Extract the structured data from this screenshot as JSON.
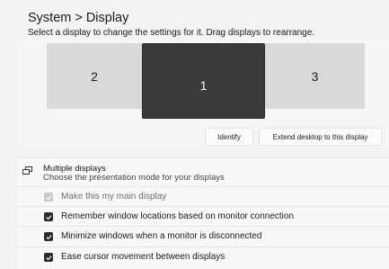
{
  "breadcrumb": {
    "parent": "System",
    "separator": ">",
    "current": "Display"
  },
  "instructions": "Select a display to change the settings for it. Drag displays to rearrange.",
  "monitors": [
    {
      "label": "2",
      "selected": false
    },
    {
      "label": "1",
      "selected": true
    },
    {
      "label": "3",
      "selected": false
    }
  ],
  "buttons": {
    "identify": "Identify",
    "extend": "Extend desktop to this display"
  },
  "multiple_displays": {
    "icon": "multiple-displays-icon",
    "title": "Multiple displays",
    "subtitle": "Choose the presentation mode for your displays",
    "options": [
      {
        "label": "Make this my main display",
        "checked": true,
        "disabled": true
      },
      {
        "label": "Remember window locations based on monitor connection",
        "checked": true,
        "disabled": false
      },
      {
        "label": "Minimize windows when a monitor is disconnected",
        "checked": true,
        "disabled": false
      },
      {
        "label": "Ease cursor movement between displays",
        "checked": true,
        "disabled": false
      }
    ]
  },
  "colors": {
    "selected_monitor": "#3b3b3b",
    "unselected_monitor": "#d9d9d9",
    "background": "#f3f3f3"
  }
}
